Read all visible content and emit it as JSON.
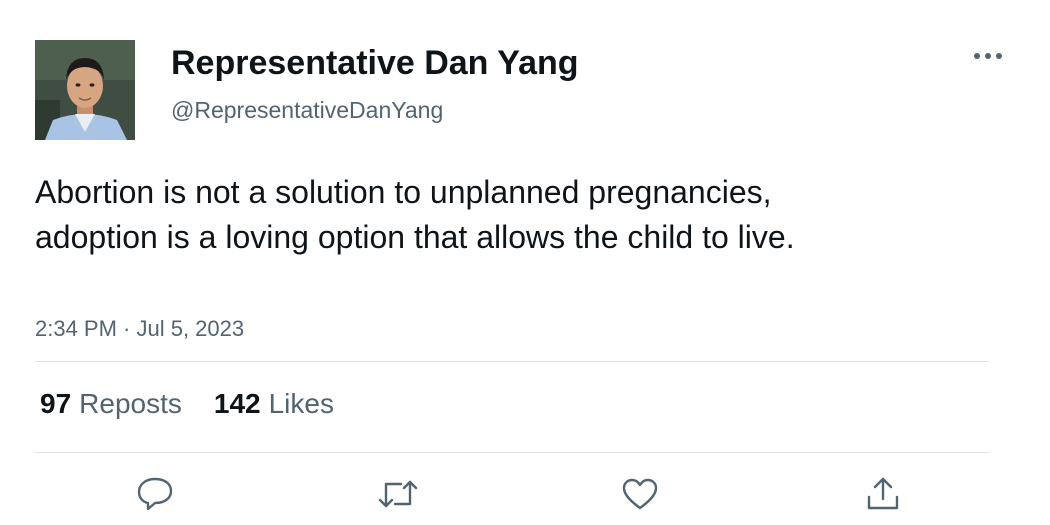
{
  "author": {
    "display_name": "Representative Dan Yang",
    "handle": "@RepresentativeDanYang"
  },
  "tweet": {
    "text": "Abortion is not a solution to unplanned pregnancies, adoption is a loving option that allows the child to live.",
    "timestamp": "2:34 PM · Jul 5, 2023"
  },
  "stats": {
    "reposts_count": "97",
    "reposts_label": "Reposts",
    "likes_count": "142",
    "likes_label": "Likes"
  },
  "icons": {
    "more": "more-icon",
    "reply": "reply-icon",
    "repost": "repost-icon",
    "like": "heart-icon",
    "share": "share-icon"
  },
  "colors": {
    "text_primary": "#0f1419",
    "text_secondary": "#536471",
    "divider": "#dfe3e6"
  }
}
